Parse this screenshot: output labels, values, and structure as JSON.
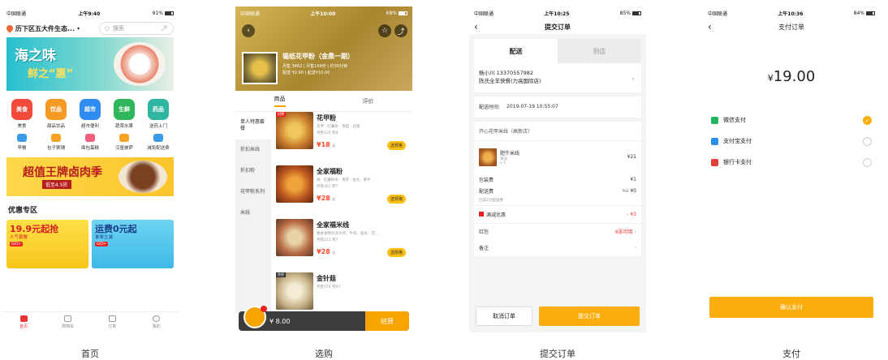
{
  "captions": [
    "首页",
    "选购",
    "提交订单",
    "支付"
  ],
  "home": {
    "status": {
      "carrier": "中国联通",
      "time": "上午9:40",
      "battery": "91%"
    },
    "location": "历下区五大件生态...",
    "search_placeholder": "搜索",
    "banner": {
      "line1": "海之味",
      "line2": "鲜之“惠”"
    },
    "categories": [
      {
        "label": "美食",
        "icon": "美食",
        "color": "#f24b3b"
      },
      {
        "label": "甜品饮品",
        "icon": "饮品",
        "color": "#f69a26"
      },
      {
        "label": "超市便利",
        "icon": "超市",
        "color": "#2f8cf0"
      },
      {
        "label": "蔬菜水果",
        "icon": "生鲜",
        "color": "#30b65a"
      },
      {
        "label": "送药上门",
        "icon": "药品",
        "color": "#30b6a0"
      }
    ],
    "categories2": [
      {
        "label": "早餐",
        "color": "#3a9ce8"
      },
      {
        "label": "包子粥铺",
        "color": "#f8a325"
      },
      {
        "label": "面包蛋糕",
        "color": "#f35f7a"
      },
      {
        "label": "汉堡披萨",
        "color": "#f8a325"
      },
      {
        "label": "减免配送费",
        "color": "#3a9ce8"
      }
    ],
    "banner2": {
      "title": "超值王牌卤肉季",
      "sub": "低至4.5折"
    },
    "section_title": "优惠专区",
    "promos": [
      {
        "title": "19.9元起抢",
        "sub": "人气套餐",
        "tag": "GO>"
      },
      {
        "title": "运费0元起",
        "sub": "单单立减",
        "tag": "GO>"
      }
    ],
    "tabs": [
      "首页",
      "购物车",
      "订单",
      "我的"
    ]
  },
  "shop": {
    "status": {
      "carrier": "中国联通",
      "time": "上午10:00",
      "battery": "68%"
    },
    "name": "锡纸花甲粉（金鼎一期）",
    "info1": "月售 3462 | 月售169份 | 约30分钟",
    "info2": "配送 ¥2.90 | 起送¥10.00",
    "tabs": [
      "商品",
      "评价"
    ],
    "side": [
      "单人特惠套餐",
      "折扣米线",
      "折扣粉",
      "花甲粉系列",
      "米线"
    ],
    "items": [
      {
        "name": "花甲粉",
        "desc": "花甲 · 红薯粉 · 香菇 · 豆腐",
        "sales": "月售135  赞8",
        "price": "¥18",
        "tag": "招牌",
        "button": "选规格"
      },
      {
        "name": "全家福粉",
        "desc": "辣 · 红薯粉条 · 青虾 · 鱼丸 · 肥牛",
        "sales": "月售301  赞7",
        "price": "¥28",
        "tag": "",
        "button": "选规格"
      },
      {
        "name": "全家福米线",
        "desc": "素食食物包含大虾、牛肉、鱼丸、花...",
        "sales": "月售221  赞7",
        "price": "¥28",
        "tag": "",
        "button": "选规格"
      },
      {
        "name": "金针菇",
        "desc": "",
        "sales": "月售574  赞47",
        "price": "",
        "tag": "热销",
        "button": ""
      }
    ],
    "price_unit": "起",
    "cart_total": "¥ 8.00",
    "checkout": "结算"
  },
  "order": {
    "status": {
      "carrier": "中国联通",
      "time": "上午10:25",
      "battery": "85%"
    },
    "title": "提交订单",
    "tabs": [
      "配送",
      "到店"
    ],
    "contact": "杨小川 13370557982",
    "address": "陈氏全羊快餐(力高国际店)",
    "time_label": "配送时间:",
    "time_value": "2019-07-19 10:55:07",
    "shop": "开心花甲米线（高新店）",
    "item": {
      "name": "肥牛米线",
      "spec": "清淡",
      "qty": "x 1",
      "price": "¥21"
    },
    "pack_label": "包装费",
    "pack_value": "¥1",
    "delivery_label": "配送费",
    "delivery_old": "¥2",
    "delivery_value": "¥0",
    "delivery_note": "已减2元配送费",
    "discount_label": "满减优惠",
    "discount_value": "- ¥3",
    "coupon_label": "红包",
    "coupon_value": "6张可用",
    "remark_label": "备注",
    "cancel": "取消订单",
    "submit": "提交订单"
  },
  "pay": {
    "status": {
      "carrier": "中国联通",
      "time": "上午10:36",
      "battery": "84%"
    },
    "title": "支付订单",
    "amount": "19.00",
    "currency": "¥",
    "methods": [
      {
        "label": "微信支付",
        "color": "#22b35e",
        "selected": true
      },
      {
        "label": "支付宝支付",
        "color": "#2c8ee8",
        "selected": false
      },
      {
        "label": "银行卡支付",
        "color": "#e0403a",
        "selected": false
      }
    ],
    "confirm": "确认支付"
  }
}
